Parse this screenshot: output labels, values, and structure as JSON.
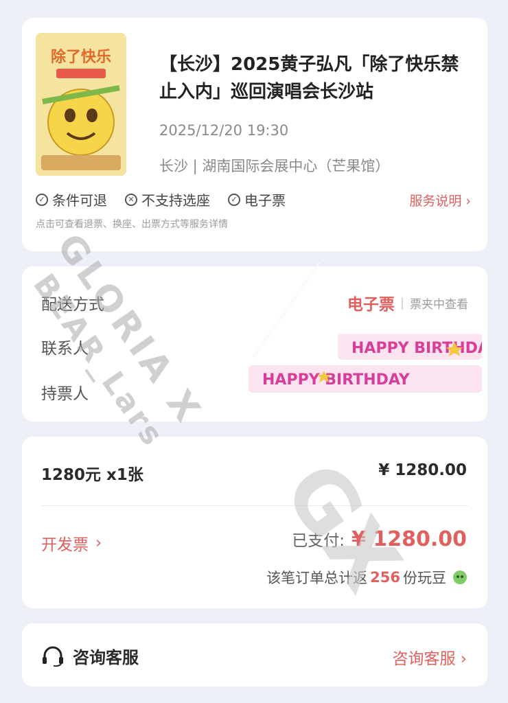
{
  "event": {
    "title": "【长沙】2025黄子弘凡「除了快乐禁止入内」巡回演唱会长沙站",
    "datetime": "2025/12/20 19:30",
    "venue": "长沙 | 湖南国际会展中心（芒果馆）",
    "poster_text": "除了快乐",
    "features": [
      {
        "icon": "check-circle-icon",
        "label": "条件可退"
      },
      {
        "icon": "x-circle-icon",
        "label": "不支持选座"
      },
      {
        "icon": "check-circle-icon",
        "label": "电子票"
      }
    ],
    "service_link": "服务说明",
    "service_subtitle": "点击可查看退票、换座、出票方式等服务详情"
  },
  "delivery": {
    "method_label": "配送方式",
    "method_value": "电子票",
    "method_note": "票夹中查看",
    "contact_label": "联系人",
    "holder_label": "持票人",
    "sticker_text": "HAPPY BIRTHDAY"
  },
  "payment": {
    "price_line": "1280元 x1张",
    "price_total": "¥ 1280.00",
    "invoice_label": "开发票",
    "paid_label": "已支付:",
    "paid_amount": "¥ 1280.00",
    "beans_prefix": "该笔订单总计返",
    "beans_value": "256",
    "beans_suffix": "份玩豆"
  },
  "customer_service": {
    "left_label": "咨询客服",
    "right_label": "咨询客服"
  },
  "watermark": {
    "line1": "GLORIA X",
    "line2": "BEAR_Lars",
    "line3": "GX"
  },
  "colors": {
    "accent": "#e0605f",
    "background": "#eef0f8",
    "card": "#ffffff"
  }
}
